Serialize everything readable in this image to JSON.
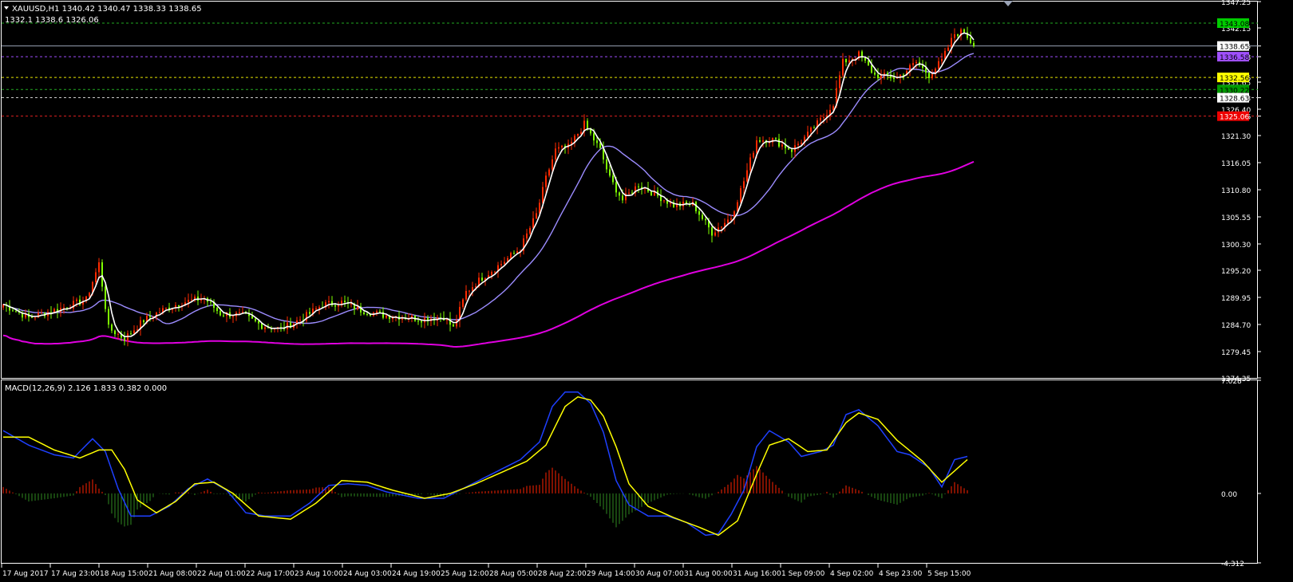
{
  "header": {
    "symbol_line": "XAUUSD,H1  1340.42 1340.47 1338.33 1338.65",
    "info_line": "1332.1 1338.6 1326.06"
  },
  "colors": {
    "background": "#000000",
    "frame": "#ffffff",
    "bull": "#ff2a00",
    "bear": "#7fff00",
    "ma_fast": "#ffffff",
    "ma_mid": "#9c8cff",
    "ma_slow": "#e000e0",
    "macd_line": "#1e40ff",
    "signal_line": "#ffff00",
    "hist_pos": "#ff2200",
    "hist_neg": "#2f8a1f"
  },
  "chart_data": [
    {
      "type": "candlestick",
      "title": "XAUUSD,H1",
      "ylim": [
        1274.35,
        1347.25
      ],
      "y_ticks": [
        "1347.25",
        "1342.15",
        "1338.65",
        "1336.58",
        "1332.56",
        "1331.65",
        "1328.63",
        "1326.40",
        "1325.06",
        "1321.30",
        "1316.05",
        "1310.80",
        "1305.55",
        "1300.30",
        "1295.20",
        "1289.95",
        "1284.70",
        "1279.45",
        "1274.35"
      ],
      "x_ticks": [
        "17 Aug 2017",
        "17 Aug 23:00",
        "18 Aug 15:00",
        "21 Aug 08:00",
        "22 Aug 01:00",
        "22 Aug 17:00",
        "23 Aug 10:00",
        "24 Aug 03:00",
        "24 Aug 19:00",
        "25 Aug 12:00",
        "28 Aug 05:00",
        "28 Aug 22:00",
        "29 Aug 14:00",
        "30 Aug 07:00",
        "31 Aug 00:00",
        "31 Aug 16:00",
        "1 Sep 09:00",
        "4 Sep 02:00",
        "4 Sep 23:00",
        "5 Sep 15:00"
      ],
      "close_anchors": [
        [
          0,
          1288.6
        ],
        [
          8,
          1286.0
        ],
        [
          18,
          1287.8
        ],
        [
          26,
          1289.5
        ],
        [
          30,
          1296.5
        ],
        [
          33,
          1284.0
        ],
        [
          38,
          1282.0
        ],
        [
          44,
          1285.5
        ],
        [
          50,
          1287.5
        ],
        [
          56,
          1289.0
        ],
        [
          63,
          1289.8
        ],
        [
          68,
          1286.8
        ],
        [
          75,
          1286.5
        ],
        [
          81,
          1284.5
        ],
        [
          87,
          1283.8
        ],
        [
          94,
          1286.0
        ],
        [
          100,
          1288.5
        ],
        [
          106,
          1289.0
        ],
        [
          112,
          1287.5
        ],
        [
          119,
          1286.5
        ],
        [
          125,
          1286.2
        ],
        [
          131,
          1285.8
        ],
        [
          138,
          1286.2
        ],
        [
          141,
          1284.0
        ],
        [
          145,
          1291.0
        ],
        [
          150,
          1293.8
        ],
        [
          156,
          1296.5
        ],
        [
          162,
          1299.5
        ],
        [
          167,
          1306.0
        ],
        [
          170,
          1313.0
        ],
        [
          173,
          1318.5
        ],
        [
          177,
          1319.0
        ],
        [
          182,
          1323.5
        ],
        [
          187,
          1318.5
        ],
        [
          190,
          1313.0
        ],
        [
          194,
          1308.8
        ],
        [
          199,
          1311.8
        ],
        [
          204,
          1310.0
        ],
        [
          210,
          1307.8
        ],
        [
          216,
          1308.0
        ],
        [
          222,
          1302.5
        ],
        [
          228,
          1305.5
        ],
        [
          232,
          1312.5
        ],
        [
          236,
          1320.5
        ],
        [
          241,
          1320.5
        ],
        [
          247,
          1318.5
        ],
        [
          252,
          1321.5
        ],
        [
          257,
          1325.0
        ],
        [
          260,
          1327.5
        ],
        [
          263,
          1335.5
        ],
        [
          268,
          1337.0
        ],
        [
          273,
          1333.0
        ],
        [
          280,
          1332.5
        ],
        [
          286,
          1335.5
        ],
        [
          290,
          1333.0
        ],
        [
          294,
          1335.8
        ],
        [
          298,
          1341.0
        ],
        [
          301,
          1341.5
        ],
        [
          304,
          1338.65
        ]
      ],
      "candle_count": 305,
      "current_price": 1338.65,
      "price_lines": [
        {
          "value": 1343.08,
          "label": "1343.08",
          "style": "dashed",
          "color": "#22aa22",
          "badge_bg": "#00cc00",
          "badge_fg": "#000000"
        },
        {
          "value": 1338.65,
          "label": "1338.65",
          "style": "solid",
          "color": "#9aa3b5",
          "badge_bg": "#ffffff",
          "badge_fg": "#000000"
        },
        {
          "value": 1336.58,
          "label": "1336.58",
          "style": "dashed",
          "color": "#a04dff",
          "badge_bg": "#a050ff",
          "badge_fg": "#000000"
        },
        {
          "value": 1332.56,
          "label": "1332.56",
          "style": "dashed",
          "color": "#e6e600",
          "badge_bg": "#ffff00",
          "badge_fg": "#000000"
        },
        {
          "value": 1330.22,
          "label": "1330.22",
          "style": "dashed",
          "color": "#22aa22",
          "badge_bg": "#009a00",
          "badge_fg": "#000000"
        },
        {
          "value": 1328.63,
          "label": "1328.63",
          "style": "dashed",
          "color": "#cccccc",
          "badge_bg": "#ffffff",
          "badge_fg": "#000000"
        },
        {
          "value": 1325.06,
          "label": "1325.06",
          "style": "dashed",
          "color": "#e02020",
          "badge_bg": "#ee0000",
          "badge_fg": "#ffffff"
        }
      ]
    },
    {
      "type": "macd",
      "title": "MACD(12,26,9) 2.126 1.833 0.382 0.000",
      "ylim": [
        -4.312,
        7.028
      ],
      "y_ticks": [
        "7.028",
        "0.00",
        "-4.312"
      ],
      "macd_anchors": [
        [
          0,
          3.9
        ],
        [
          8,
          3.0
        ],
        [
          16,
          2.4
        ],
        [
          22,
          2.2
        ],
        [
          28,
          3.4
        ],
        [
          32,
          2.6
        ],
        [
          36,
          0.3
        ],
        [
          40,
          -1.4
        ],
        [
          46,
          -1.4
        ],
        [
          52,
          -0.8
        ],
        [
          58,
          0.3
        ],
        [
          64,
          0.9
        ],
        [
          70,
          0.2
        ],
        [
          76,
          -1.2
        ],
        [
          82,
          -1.4
        ],
        [
          90,
          -1.4
        ],
        [
          96,
          -0.6
        ],
        [
          102,
          0.5
        ],
        [
          108,
          0.6
        ],
        [
          114,
          0.5
        ],
        [
          120,
          0.1
        ],
        [
          130,
          -0.3
        ],
        [
          138,
          -0.3
        ],
        [
          146,
          0.5
        ],
        [
          154,
          1.3
        ],
        [
          162,
          2.1
        ],
        [
          168,
          3.2
        ],
        [
          172,
          5.4
        ],
        [
          176,
          6.3
        ],
        [
          180,
          6.3
        ],
        [
          184,
          5.6
        ],
        [
          188,
          3.8
        ],
        [
          192,
          0.8
        ],
        [
          196,
          -0.7
        ],
        [
          202,
          -1.4
        ],
        [
          208,
          -1.4
        ],
        [
          214,
          -1.8
        ],
        [
          220,
          -2.6
        ],
        [
          224,
          -2.5
        ],
        [
          228,
          -1.3
        ],
        [
          232,
          0.2
        ],
        [
          236,
          2.9
        ],
        [
          240,
          3.9
        ],
        [
          246,
          3.2
        ],
        [
          250,
          2.3
        ],
        [
          256,
          2.6
        ],
        [
          260,
          3.0
        ],
        [
          264,
          4.9
        ],
        [
          268,
          5.2
        ],
        [
          274,
          4.2
        ],
        [
          280,
          2.6
        ],
        [
          284,
          2.4
        ],
        [
          290,
          1.6
        ],
        [
          294,
          0.4
        ],
        [
          298,
          2.1
        ],
        [
          302,
          2.3
        ]
      ],
      "signal_anchors": [
        [
          0,
          3.5
        ],
        [
          8,
          3.5
        ],
        [
          16,
          2.7
        ],
        [
          24,
          2.2
        ],
        [
          30,
          2.7
        ],
        [
          34,
          2.7
        ],
        [
          38,
          1.5
        ],
        [
          42,
          -0.4
        ],
        [
          48,
          -1.2
        ],
        [
          54,
          -0.5
        ],
        [
          60,
          0.6
        ],
        [
          66,
          0.7
        ],
        [
          72,
          0.0
        ],
        [
          80,
          -1.4
        ],
        [
          90,
          -1.6
        ],
        [
          98,
          -0.6
        ],
        [
          106,
          0.8
        ],
        [
          114,
          0.7
        ],
        [
          122,
          0.2
        ],
        [
          132,
          -0.3
        ],
        [
          140,
          0.0
        ],
        [
          148,
          0.6
        ],
        [
          156,
          1.3
        ],
        [
          164,
          2.0
        ],
        [
          170,
          3.0
        ],
        [
          176,
          5.4
        ],
        [
          180,
          6.0
        ],
        [
          184,
          5.8
        ],
        [
          188,
          4.8
        ],
        [
          192,
          2.9
        ],
        [
          196,
          0.6
        ],
        [
          202,
          -0.8
        ],
        [
          210,
          -1.5
        ],
        [
          218,
          -2.1
        ],
        [
          224,
          -2.6
        ],
        [
          230,
          -1.7
        ],
        [
          236,
          1.2
        ],
        [
          240,
          3.0
        ],
        [
          246,
          3.4
        ],
        [
          252,
          2.6
        ],
        [
          258,
          2.7
        ],
        [
          264,
          4.4
        ],
        [
          268,
          5.0
        ],
        [
          274,
          4.6
        ],
        [
          280,
          3.3
        ],
        [
          288,
          2.0
        ],
        [
          294,
          0.7
        ],
        [
          298,
          1.4
        ],
        [
          302,
          2.1
        ]
      ]
    }
  ]
}
